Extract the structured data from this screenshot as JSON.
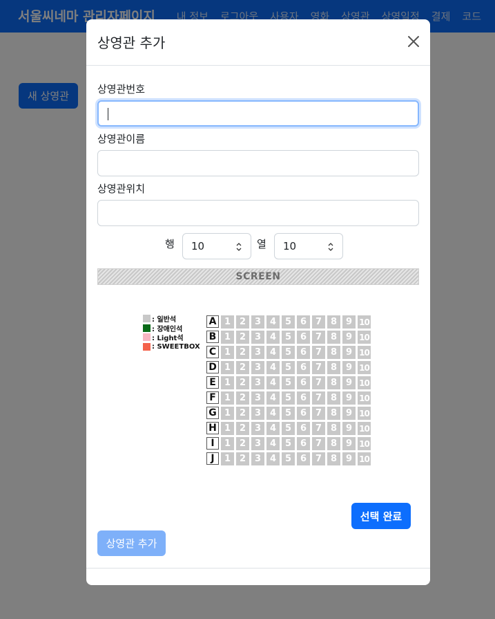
{
  "app": {
    "brand": "서울씨네마 관리자페이지",
    "nav": [
      "내 정보",
      "로그아웃",
      "사용자",
      "영화",
      "상영관",
      "상영일정",
      "결제",
      "코드"
    ],
    "new_theater_button": "새 상영관"
  },
  "modal": {
    "title": "상영관 추가",
    "close_icon": "close-icon",
    "fields": {
      "number": {
        "label": "상영관번호",
        "value": ""
      },
      "name": {
        "label": "상영관이름",
        "value": ""
      },
      "location": {
        "label": "상영관위치",
        "value": ""
      }
    },
    "rows_label": "행",
    "rows_value": "10",
    "cols_label": "열",
    "cols_value": "10",
    "screen_label": "SCREEN",
    "legend": [
      {
        "label": ": 일반석",
        "color": "#c8c8c8"
      },
      {
        "label": ": 장애인석",
        "color": "#0a6b18"
      },
      {
        "label": ": Light석",
        "color": "#f7b6c2"
      },
      {
        "label": ": SWEETBOX",
        "color": "#f4624b"
      }
    ],
    "seat_rows": [
      "A",
      "B",
      "C",
      "D",
      "E",
      "F",
      "G",
      "H",
      "I",
      "J"
    ],
    "seat_numbers": [
      "1",
      "2",
      "3",
      "4",
      "5",
      "6",
      "7",
      "8",
      "9",
      "10"
    ],
    "select_done_button": "선택 완료",
    "add_button": "상영관 추가"
  },
  "colors": {
    "primary": "#0d6efd",
    "primary_disabled": "#7eb0f9",
    "seat_default": "#c8c8c8"
  }
}
